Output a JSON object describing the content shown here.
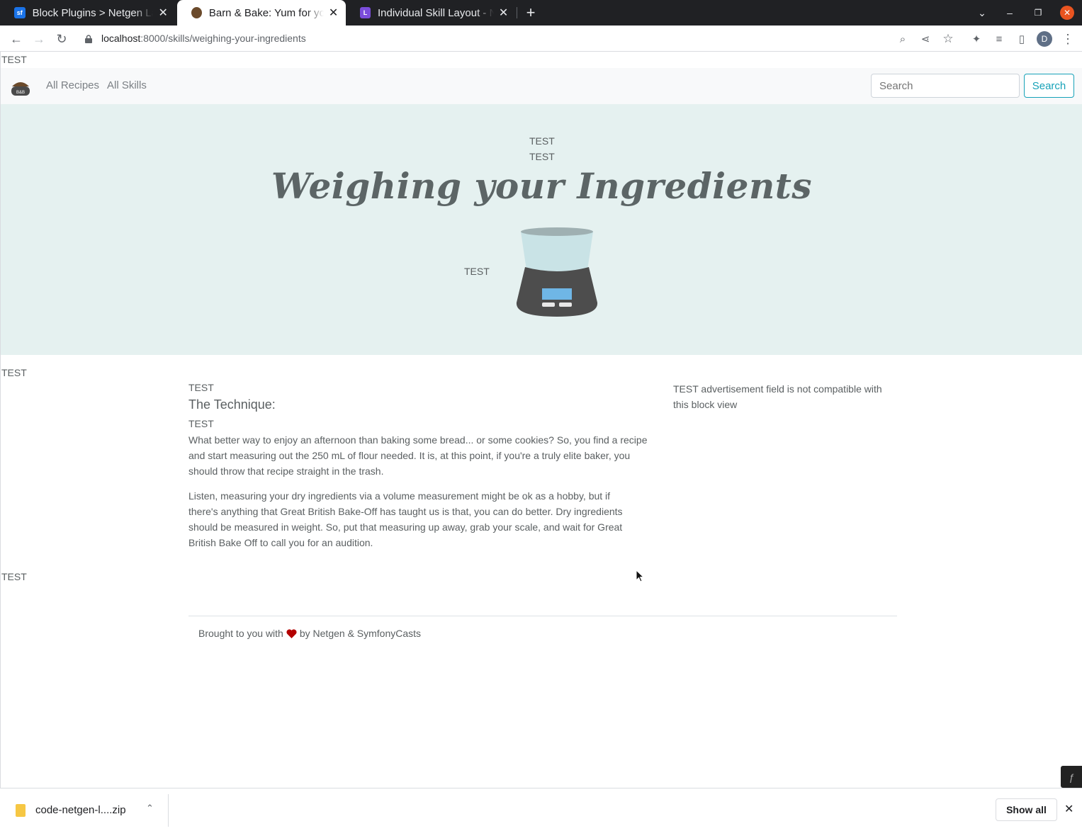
{
  "browser": {
    "tabs": [
      {
        "title": "Block Plugins > Netgen Layouts",
        "favicon": "sf",
        "favicon_color": "#1a73e8"
      },
      {
        "title": "Barn & Bake: Yum for your tummy",
        "favicon": "bb",
        "favicon_color": "#6b4a2b"
      },
      {
        "title": "Individual Skill Layout - Netgen Layouts",
        "favicon": "L",
        "favicon_color": "#7b4ddb"
      }
    ],
    "url_host": "localhost",
    "url_path": ":8000/skills/weighing-your-ingredients",
    "profile_initial": "D"
  },
  "page": {
    "top_test": "TEST",
    "nav": {
      "links": [
        "All Recipes",
        "All Skills"
      ],
      "search_placeholder": "Search",
      "search_button": "Search"
    },
    "hero": {
      "test1": "TEST",
      "test2": "TEST",
      "title": "Weighing your Ingredients",
      "image_test": "TEST"
    },
    "section_test1": "TEST",
    "main": {
      "test_a": "TEST",
      "heading": "The Technique:",
      "test_b": "TEST",
      "para1": "What better way to enjoy an afternoon than baking some bread... or some cookies? So, you find a recipe and start measuring out the 250 mL of flour needed. It is, at this point, if you're a truly elite baker, you should throw that recipe straight in the trash.",
      "para2": "Listen, measuring your dry ingredients via a volume measurement might be ok as a hobby, but if there's anything that Great British Bake-Off has taught us is that, you can do better. Dry ingredients should be measured in weight. So, put that measuring up away, grab your scale, and wait for Great British Bake Off to call you for an audition."
    },
    "sidebar_text": "TEST advertisement field is not compatible with this block view",
    "section_test2": "TEST",
    "footer": {
      "before": "Brought to you with",
      "after": "by Netgen & SymfonyCasts",
      "heart_color": "#b30000"
    }
  },
  "downloads": {
    "file": "code-netgen-l....zip",
    "show_all": "Show all"
  }
}
